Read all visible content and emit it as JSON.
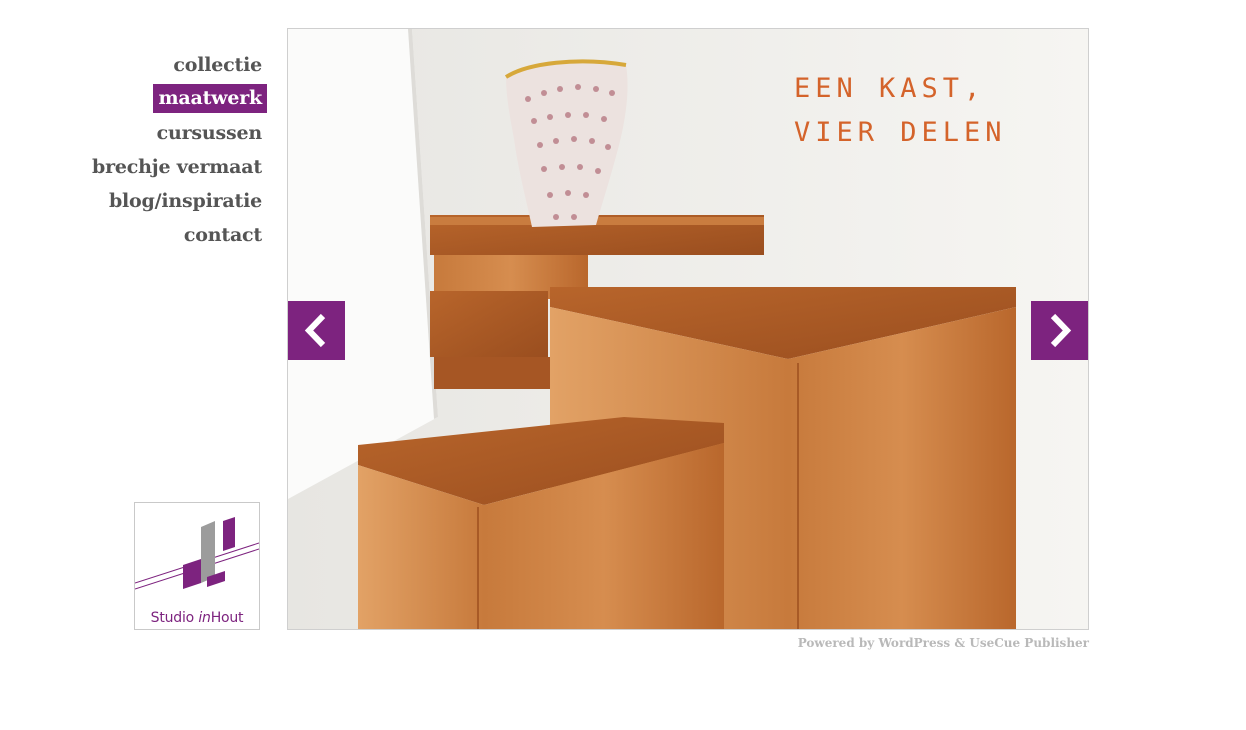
{
  "nav": {
    "items": [
      {
        "label": "collectie",
        "active": false
      },
      {
        "label": "maatwerk",
        "active": true
      },
      {
        "label": "cursussen",
        "active": false
      },
      {
        "label": "brechje vermaat",
        "active": false
      },
      {
        "label": "blog/inspiratie",
        "active": false
      },
      {
        "label": "contact",
        "active": false
      }
    ]
  },
  "logo": {
    "name_part1": "Studio ",
    "name_part2": "in",
    "name_part3": "Hout"
  },
  "slide": {
    "caption_line1": "EEN KAST,",
    "caption_line2": "VIER DELEN",
    "prev_icon": "chevron-left-icon",
    "next_icon": "chevron-right-icon"
  },
  "footer": {
    "powered_by": "Powered by ",
    "wordpress": "WordPress",
    "amp": " & ",
    "usecue": "UseCue Publisher"
  },
  "colors": {
    "brand": "#7d237f",
    "caption": "#d4632a",
    "nav_text": "#555555",
    "footer_text": "#b9b9b9"
  }
}
